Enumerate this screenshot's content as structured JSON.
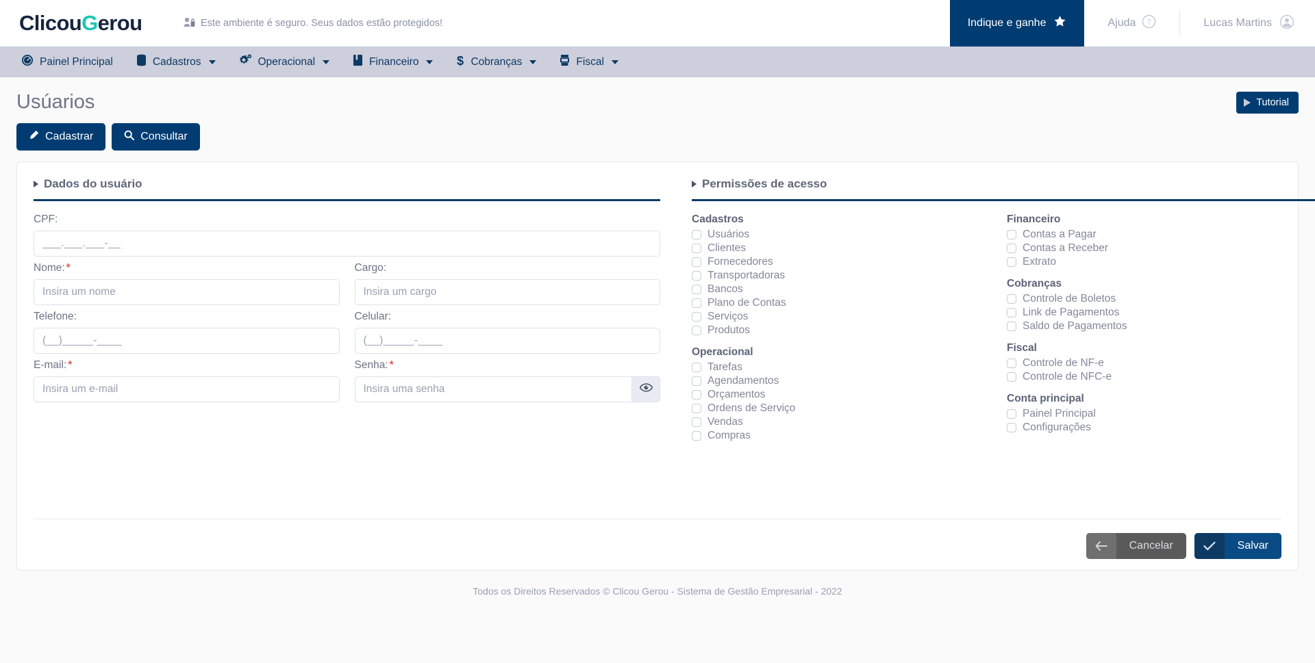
{
  "brand": {
    "part1": "Clicou",
    "accent": "G",
    "part2": "erou",
    "accent_color": "#18c8b4",
    "dark_color": "#16243f"
  },
  "topbar": {
    "secure_note": "Este ambiente é seguro. Seus dados estão protegidos!",
    "indique_label": "Indique e ganhe",
    "ajuda_label": "Ajuda",
    "user_name": "Lucas Martins",
    "indique_bg": "#003c71"
  },
  "nav": {
    "items": [
      {
        "label": "Painel Principal",
        "icon": "dashboard-icon",
        "has_caret": false
      },
      {
        "label": "Cadastros",
        "icon": "database-icon",
        "has_caret": true
      },
      {
        "label": "Operacional",
        "icon": "gears-icon",
        "has_caret": true
      },
      {
        "label": "Financeiro",
        "icon": "book-icon",
        "has_caret": true
      },
      {
        "label": "Cobranças",
        "icon": "dollar-icon",
        "has_caret": true
      },
      {
        "label": "Fiscal",
        "icon": "calculator-icon",
        "has_caret": true
      }
    ],
    "bg": "#cdcfdd",
    "text_color": "#0d3a63"
  },
  "page": {
    "title": "Usúarios",
    "tutorial_label": "Tutorial",
    "tabs": [
      {
        "label": "Cadastrar",
        "icon": "pencil-icon"
      },
      {
        "label": "Consultar",
        "icon": "search-icon"
      }
    ]
  },
  "form": {
    "section_title": "Dados do usuário",
    "fields": {
      "cpf": {
        "label": "CPF:",
        "placeholder": "___.___.___-__",
        "required": false
      },
      "nome": {
        "label": "Nome:",
        "placeholder": "Insira um nome",
        "required": true
      },
      "cargo": {
        "label": "Cargo:",
        "placeholder": "Insira um cargo",
        "required": false
      },
      "telefone": {
        "label": "Telefone:",
        "placeholder": "(__)_____-____",
        "required": false
      },
      "celular": {
        "label": "Celular:",
        "placeholder": "(__)_____-____",
        "required": false
      },
      "email": {
        "label": "E-mail:",
        "placeholder": "Insira um e-mail",
        "required": true
      },
      "senha": {
        "label": "Senha:",
        "placeholder": "Insira uma senha",
        "required": true
      }
    },
    "required_marker": "*"
  },
  "permissions": {
    "section_title": "Permissões de acesso",
    "left_groups": [
      {
        "title": "Cadastros",
        "items": [
          "Usuários",
          "Clientes",
          "Fornecedores",
          "Transportadoras",
          "Bancos",
          "Plano de Contas",
          "Serviços",
          "Produtos"
        ]
      },
      {
        "title": "Operacional",
        "items": [
          "Tarefas",
          "Agendamentos",
          "Orçamentos",
          "Ordens de Serviço",
          "Vendas",
          "Compras"
        ]
      }
    ],
    "right_groups": [
      {
        "title": "Financeiro",
        "items": [
          "Contas a Pagar",
          "Contas a Receber",
          "Extrato"
        ]
      },
      {
        "title": "Cobranças",
        "items": [
          "Controle de Boletos",
          "Link de Pagamentos",
          "Saldo de Pagamentos"
        ]
      },
      {
        "title": "Fiscal",
        "items": [
          "Controle de NF-e",
          "Controle de NFC-e"
        ]
      },
      {
        "title": "Conta principal",
        "items": [
          "Painel Principal",
          "Configurações"
        ]
      }
    ]
  },
  "actions": {
    "cancel_label": "Cancelar",
    "save_label": "Salvar"
  },
  "footer": {
    "text": "Todos os Direitos Reservados © Clicou Gerou - Sistema de Gestão Empresarial - 2022"
  }
}
